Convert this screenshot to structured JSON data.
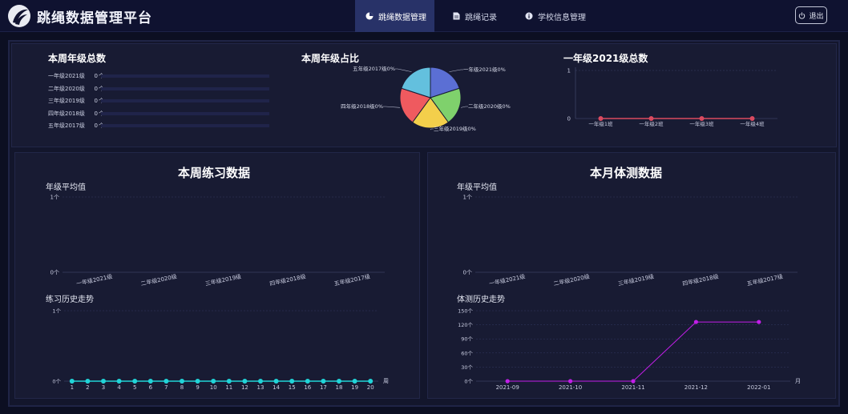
{
  "header": {
    "app_title": "跳绳数据管理平台",
    "logo_icon": "jump-rope-figure-logo",
    "tabs": [
      {
        "label": "跳绳数据管理",
        "icon": "pie-chart-icon",
        "active": true
      },
      {
        "label": "跳绳记录",
        "icon": "document-icon",
        "active": false
      },
      {
        "label": "学校信息管理",
        "icon": "info-icon",
        "active": false
      }
    ],
    "logout_label": "退出"
  },
  "weekly_grade_total": {
    "title": "本周年级总数",
    "unit": "个",
    "rows": [
      {
        "grade": "一年级2021级",
        "value": 0
      },
      {
        "grade": "二年级2020级",
        "value": 0
      },
      {
        "grade": "三年级2019级",
        "value": 0
      },
      {
        "grade": "四年级2018级",
        "value": 0
      },
      {
        "grade": "五年级2017级",
        "value": 0
      }
    ]
  },
  "grade_share": {
    "title": "本周年级占比"
  },
  "class_total": {
    "title": "一年级2021级总数"
  },
  "weekly_practice": {
    "title": "本周练习数据",
    "avg_label": "年级平均值",
    "history_label": "练习历史走势"
  },
  "monthly_test": {
    "title": "本月体测数据",
    "avg_label": "年级平均值",
    "history_label": "体测历史走势"
  },
  "colors": {
    "background": "#0c0f22",
    "panel": "#181b33",
    "active_tab": "#283268",
    "class_line": "#d94a60",
    "practice_line": "#21d4d8",
    "test_line": "#c21ee8"
  },
  "chart_data": [
    {
      "type": "pie",
      "labels": [
        "一年级2021级0%",
        "二年级2020级0%",
        "三年级2019级0%",
        "四年级2018级0%",
        "五年级2017级0%"
      ],
      "values": [
        20,
        20,
        20,
        20,
        20
      ],
      "colors": [
        "#5b6fd4",
        "#7fd16c",
        "#f3cf4b",
        "#ef5a5f",
        "#63c0de"
      ]
    },
    {
      "type": "line",
      "categories": [
        "一年级1班",
        "一年级2班",
        "一年级3班",
        "一年级4班"
      ],
      "series": [
        {
          "values": [
            0,
            0,
            0,
            0
          ]
        }
      ],
      "y_ticks": [
        "0",
        "1"
      ],
      "ylim": [
        0,
        1
      ]
    },
    {
      "type": "bar",
      "categories": [
        "一年级2021级",
        "二年级2020级",
        "三年级2019级",
        "四年级2018级",
        "五年级2017级"
      ],
      "values": [
        0,
        0,
        0,
        0,
        0
      ],
      "y_ticks": [
        "0个",
        "1个"
      ],
      "ylim": [
        0,
        1
      ]
    },
    {
      "type": "line",
      "x": [
        "1",
        "2",
        "3",
        "4",
        "5",
        "6",
        "7",
        "8",
        "9",
        "10",
        "11",
        "12",
        "13",
        "14",
        "15",
        "16",
        "17",
        "18",
        "19",
        "20"
      ],
      "series": [
        {
          "values": [
            0,
            0,
            0,
            0,
            0,
            0,
            0,
            0,
            0,
            0,
            0,
            0,
            0,
            0,
            0,
            0,
            0,
            0,
            0,
            0
          ]
        }
      ],
      "y_ticks": [
        "0个",
        "1个"
      ],
      "ylim": [
        0,
        1
      ],
      "x_unit": "周"
    },
    {
      "type": "bar",
      "categories": [
        "一年级2021级",
        "二年级2020级",
        "三年级2019级",
        "四年级2018级",
        "五年级2017级"
      ],
      "values": [
        0,
        0,
        0,
        0,
        0
      ],
      "y_ticks": [
        "0个",
        "1个"
      ],
      "ylim": [
        0,
        1
      ]
    },
    {
      "type": "line",
      "x": [
        "2021-09",
        "2021-10",
        "2021-11",
        "2021-12",
        "2022-01"
      ],
      "series": [
        {
          "values": [
            0,
            0,
            0,
            126,
            126
          ]
        }
      ],
      "y_ticks": [
        "0个",
        "30个",
        "60个",
        "90个",
        "120个",
        "150个"
      ],
      "ylim": [
        0,
        150
      ],
      "x_unit": "月"
    }
  ]
}
